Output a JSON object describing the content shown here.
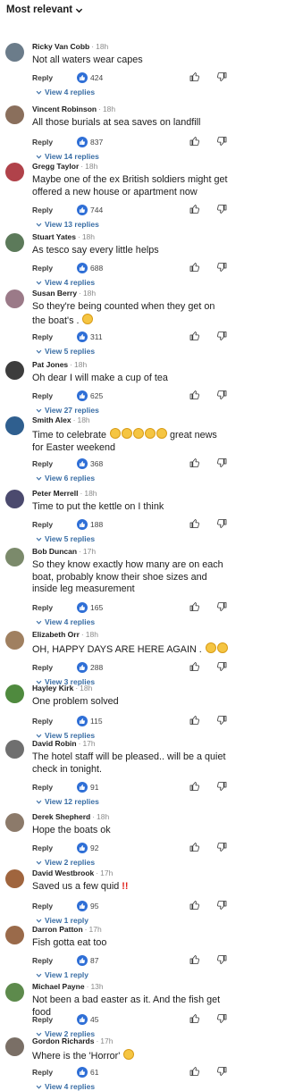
{
  "header": {
    "sort_label": "Most relevant"
  },
  "ui": {
    "reply_label": "Reply"
  },
  "colors": {
    "like_badge": "#2f6fd6",
    "view_link": "#3a6ea5"
  },
  "comments": [
    {
      "name": "Ricky Van Cobb",
      "age": "18h",
      "text": "Not all waters wear capes",
      "likes": "424",
      "view_replies": "View 4 replies",
      "avatar": "#6b7c8a"
    },
    {
      "name": "Vincent Robinson",
      "age": "18h",
      "text": "All those burials at sea saves on landfill",
      "likes": "837",
      "view_replies": "View 14 replies",
      "avatar": "#8a6f5c"
    },
    {
      "name": "Gregg Taylor",
      "age": "18h",
      "text": "Maybe one of the ex British soldiers might get offered a new house or apartment now",
      "likes": "744",
      "view_replies": "View 13 replies",
      "avatar": "#b0424a"
    },
    {
      "name": "Stuart Yates",
      "age": "18h",
      "text": "As tesco say every little helps",
      "likes": "688",
      "view_replies": "View 4 replies",
      "avatar": "#5c7a5a"
    },
    {
      "name": "Susan Berry",
      "age": "18h",
      "text": "So they're being counted when they get on the boat's .",
      "likes": "311",
      "view_replies": "View 5 replies",
      "avatar": "#9b7a88"
    },
    {
      "name": "Pat Jones",
      "age": "18h",
      "text": "Oh dear I will make a cup of tea",
      "likes": "625",
      "view_replies": "View 27 replies",
      "avatar": "#3d3d3d"
    },
    {
      "name": "Smith Alex",
      "age": "18h",
      "text": "Time to celebrate  great news for Easter weekend",
      "likes": "368",
      "view_replies": "View 6 replies",
      "avatar": "#2f5f8f"
    },
    {
      "name": "Peter Merrell",
      "age": "18h",
      "text": "Time to put the kettle on I think",
      "likes": "188",
      "view_replies": "View 5 replies",
      "avatar": "#4b4a6e"
    },
    {
      "name": "Bob Duncan",
      "age": "17h",
      "text": "So they know exactly how many are on each boat, probably know their shoe sizes and inside leg measurement",
      "likes": "165",
      "view_replies": "View 4 replies",
      "avatar": "#7b8a6b"
    },
    {
      "name": "Elizabeth Orr",
      "age": "18h",
      "text": "OH,  HAPPY DAYS ARE HERE AGAIN .",
      "likes": "288",
      "view_replies": "View 3 replies",
      "avatar": "#a08060"
    },
    {
      "name": "Hayley Kirk",
      "age": "18h",
      "text": "One problem  solved",
      "likes": "115",
      "view_replies": "View 5 replies",
      "avatar": "#4f8a3e"
    },
    {
      "name": "David Robin",
      "age": "17h",
      "text": "The hotel staff will be pleased.. will be a quiet check in tonight.",
      "likes": "91",
      "view_replies": "View 12 replies",
      "avatar": "#6f6f6f"
    },
    {
      "name": "Derek Shepherd",
      "age": "18h",
      "text": "Hope the boats ok",
      "likes": "92",
      "view_replies": "View 2 replies",
      "avatar": "#8c7a6a"
    },
    {
      "name": "David Westbrook",
      "age": "17h",
      "text": "Saved us a few quid",
      "likes": "95",
      "view_replies": "View 1 reply",
      "avatar": "#a0653e"
    },
    {
      "name": "Darron Patton",
      "age": "17h",
      "text": "Fish gotta eat too",
      "likes": "87",
      "view_replies": "View 1 reply",
      "avatar": "#9a6a4a"
    },
    {
      "name": "Michael Payne",
      "age": "13h",
      "text": "Not been a bad easter as it. And the fish get food",
      "likes": "45",
      "view_replies": "View 2 replies",
      "avatar": "#5d8a4c"
    },
    {
      "name": "Gordon Richards",
      "age": "17h",
      "text": "Where is the 'Horror'",
      "likes": "61",
      "view_replies": "View 4 replies",
      "avatar": "#7a6f66"
    }
  ]
}
